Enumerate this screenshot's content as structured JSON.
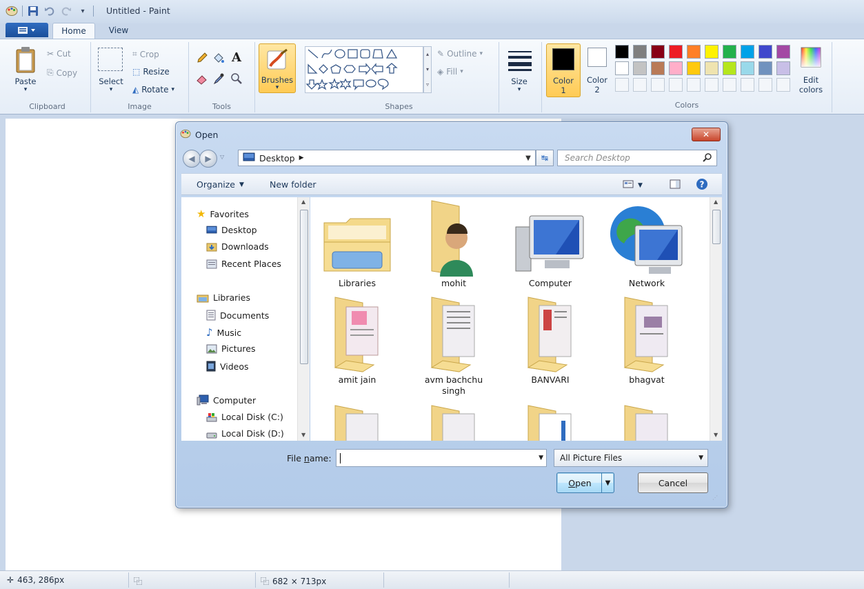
{
  "window": {
    "title": "Untitled - Paint"
  },
  "tabs": {
    "home": "Home",
    "view": "View"
  },
  "ribbon": {
    "clipboard": {
      "paste": "Paste",
      "cut": "Cut",
      "copy": "Copy",
      "label": "Clipboard"
    },
    "image": {
      "select": "Select",
      "crop": "Crop",
      "resize": "Resize",
      "rotate": "Rotate",
      "label": "Image"
    },
    "tools": {
      "label": "Tools",
      "text_tool": "A"
    },
    "brushes": {
      "label": "Brushes"
    },
    "shapes": {
      "outline": "Outline",
      "fill": "Fill",
      "label": "Shapes"
    },
    "size": {
      "label": "Size"
    },
    "colors": {
      "color1": "Color 1",
      "color1_line1": "Color",
      "color1_line2": "1",
      "color2_line1": "Color",
      "color2_line2": "2",
      "edit_colors_line1": "Edit",
      "edit_colors_line2": "colors",
      "label": "Colors",
      "color1_value": "#000000",
      "color2_value": "#ffffff",
      "palette_row1": [
        "#000000",
        "#7f7f7f",
        "#880015",
        "#ed1c24",
        "#ff7f27",
        "#fff200",
        "#22b14c",
        "#00a2e8",
        "#3f48cc",
        "#a349a4"
      ],
      "palette_row2": [
        "#ffffff",
        "#c3c3c3",
        "#b97a57",
        "#ffaec9",
        "#ffc90e",
        "#efe4b0",
        "#b5e61d",
        "#99d9ea",
        "#7092be",
        "#c8bfe7"
      ]
    }
  },
  "status": {
    "cursor_pos": "463, 286px",
    "image_size": "682 × 713px"
  },
  "dialog": {
    "title": "Open",
    "address": "Desktop",
    "search_placeholder": "Search Desktop",
    "toolbar": {
      "organize": "Organize",
      "new_folder": "New folder"
    },
    "nav": {
      "favorites": "Favorites",
      "desktop": "Desktop",
      "downloads": "Downloads",
      "recent": "Recent Places",
      "libraries": "Libraries",
      "documents": "Documents",
      "music": "Music",
      "pictures": "Pictures",
      "videos": "Videos",
      "computer": "Computer",
      "disk_c": "Local Disk (C:)",
      "disk_d": "Local Disk (D:)"
    },
    "items": [
      "Libraries",
      "mohit",
      "Computer",
      "Network",
      "amit jain",
      "avm bachchu singh",
      "BANVARI",
      "bhagvat"
    ],
    "file_name_label_pre": "File ",
    "file_name_label_u": "n",
    "file_name_label_post": "ame:",
    "file_name_value": "",
    "file_type": "All Picture Files",
    "open_label_u": "O",
    "open_label_rest": "pen",
    "cancel_label": "Cancel"
  }
}
